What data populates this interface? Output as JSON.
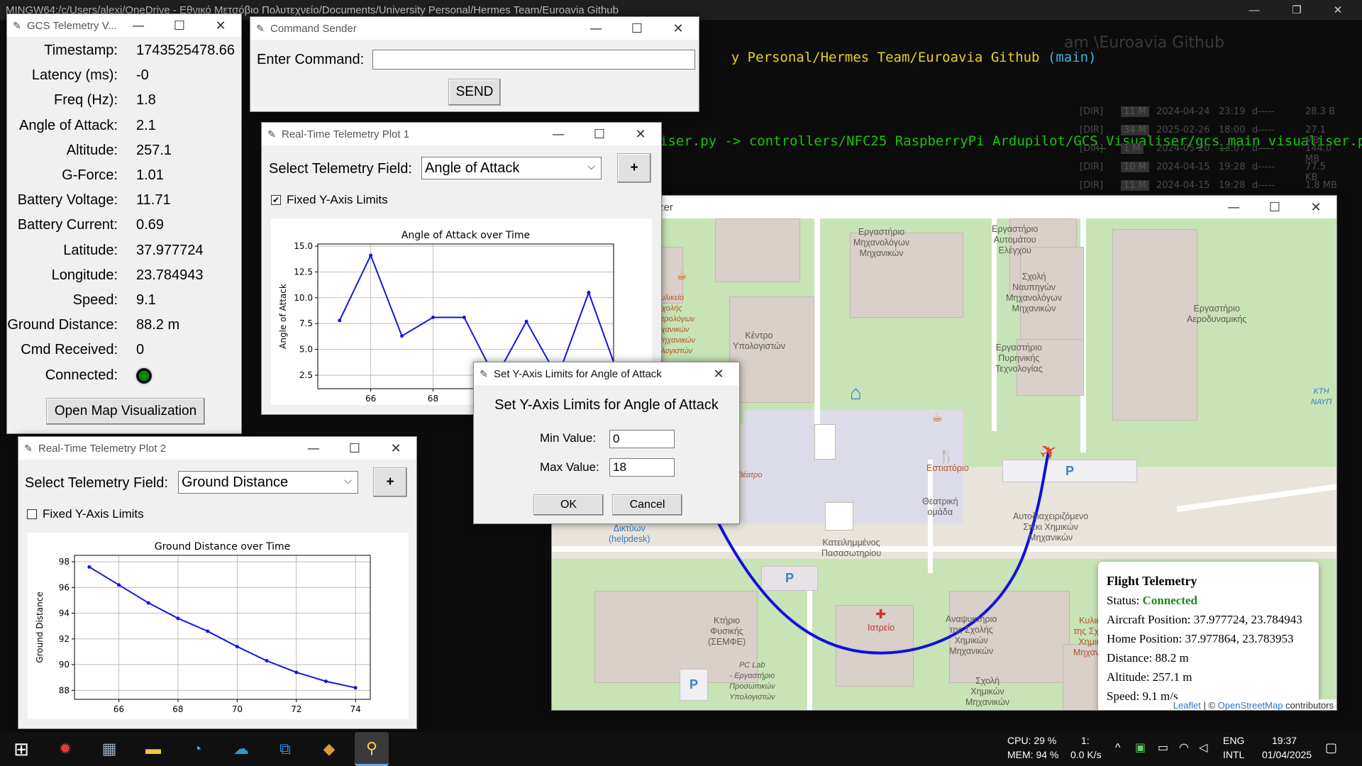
{
  "terminal": {
    "title": "MINGW64:/c/Users/alexi/OneDrive - Εθνικό Μετσόβιο Πολυτεχνείο/Documents/University Personal/Hermes Team/Euroavia Github",
    "path_line": "y Personal/Hermes Team/Euroavia Github",
    "branch": "(main)",
    "rename_line": "iser.py -> controllers/NFC25 RaspberryPi Ardupilot/GCS_Visualiser/gcs_main_visualiser.p",
    "ghost_path": "am \\Euroavia Github",
    "ghost_rows": [
      {
        "name": "[DIR]",
        "size": "11 M",
        "date": "2024-04-24",
        "time": "23:19",
        "attr": "d-----",
        "bytes": "28.3 B"
      },
      {
        "name": "[DIR]",
        "size": "34 M",
        "date": "2025-02-26",
        "time": "18:00",
        "attr": "d-----",
        "bytes": "27.1 MB"
      },
      {
        "name": "[DIR]",
        "size": "1 M",
        "date": "2024-05-20",
        "time": "13:07",
        "attr": "d-----",
        "bytes": "144.0 MB"
      },
      {
        "name": "[DIR]",
        "size": "10 M",
        "date": "2024-04-15",
        "time": "19:28",
        "attr": "d-----",
        "bytes": "77.5 KB"
      },
      {
        "name": "[DIR]",
        "size": "11 M",
        "date": "2024-04-15",
        "time": "19:28",
        "attr": "d-----",
        "bytes": "1.8 MB"
      }
    ]
  },
  "telemetry_window": {
    "title": "GCS Telemetry V...",
    "fields": [
      {
        "label": "Timestamp:",
        "value": "1743525478.66"
      },
      {
        "label": "Latency (ms):",
        "value": "-0"
      },
      {
        "label": "Freq (Hz):",
        "value": "1.8"
      },
      {
        "label": "Angle of Attack:",
        "value": "2.1"
      },
      {
        "label": "Altitude:",
        "value": "257.1"
      },
      {
        "label": "G-Force:",
        "value": "1.01"
      },
      {
        "label": "Battery Voltage:",
        "value": "11.71"
      },
      {
        "label": "Battery Current:",
        "value": "0.69"
      },
      {
        "label": "Latitude:",
        "value": "37.977724"
      },
      {
        "label": "Longitude:",
        "value": "23.784943"
      },
      {
        "label": "Speed:",
        "value": "9.1"
      },
      {
        "label": "Ground Distance:",
        "value": "88.2 m"
      },
      {
        "label": "Cmd Received:",
        "value": "0"
      }
    ],
    "connected_label": "Connected:",
    "connected_color": "#0a8a0a",
    "open_map_button": "Open Map Visualization"
  },
  "command_window": {
    "title": "Command Sender",
    "label": "Enter Command:",
    "input_value": "",
    "send_button": "SEND"
  },
  "plot1_window": {
    "title": "Real-Time Telemetry Plot 1",
    "select_label": "Select Telemetry Field:",
    "selected_field": "Angle of Attack",
    "add_button": "+",
    "fixed_limits_label": "Fixed Y-Axis Limits",
    "fixed_limits_checked": true,
    "check_mark": "✔"
  },
  "plot2_window": {
    "title": "Real-Time Telemetry Plot 2",
    "select_label": "Select Telemetry Field:",
    "selected_field": "Ground Distance",
    "add_button": "+",
    "fixed_limits_label": "Fixed Y-Axis Limits",
    "fixed_limits_checked": false
  },
  "dialog": {
    "title": "Set Y-Axis Limits for Angle of Attack",
    "heading": "Set Y-Axis Limits for Angle of Attack",
    "min_label": "Min Value:",
    "min_value": "0",
    "max_label": "Max Value:",
    "max_value": "18",
    "ok_button": "OK",
    "cancel_button": "Cancel"
  },
  "map_window": {
    "title": "zer",
    "popup": {
      "title": "Flight Telemetry",
      "status_label": "Status:",
      "status_value": "Connected",
      "aircraft": "Aircraft Position: 37.977724, 23.784943",
      "home": "Home Position: 37.977864, 23.783953",
      "distance": "Distance: 88.2 m",
      "altitude": "Altitude: 257.1 m",
      "speed": "Speed: 9.1 m/s"
    },
    "attribution_leaflet": "Leaflet",
    "attribution_sep": "| ©",
    "attribution_osm": "OpenStreetMap",
    "attribution_rest": "contributors",
    "labels": [
      "Εργαστήριο\nΑυτομάτου\nΕλέγχου",
      "Εργαστήριο\nΜηχανολόγων\nΜηχανικών",
      "Σχολή\nΝαυπηγών\nΜηχανολόγων\nΜηχανικών",
      "Εργαστήριο\nΑεροδυναμικής",
      "Κέντρο\nΥπολογιστών",
      "Κυλικείο\nΣχολής\nΗλεκτρολόγων\nΜηχανικών\nκαι Μηχανικών\nΥπολογιστών",
      "Εργαστήριο\nΠυρηνικής\nΤεχνολογίας",
      "Εστιατόριο",
      "Θεατρική\nομάδα",
      "Αυτοδιαχειριζόμενο\nΣτέκι Χημικών\nΜηχανικών",
      "Κατειλημμένος\nΠασασωτηρίου",
      "Κτήριο\nΦυσικής\n(ΣΕΜΦΕ)",
      "Ιατρείο",
      "Αναψυκτήριο\nτης Σχολής\nΧημικών\nΜηχανικών",
      "Κυλικείο\nτης Σχολής\nΧημικών\nΜηχανικών",
      "Σχολή\nΧημικών\nΜηχανικών",
      "PC Lab\n- Εργαστήριο\nΠροσωπικών\nΥπολογιστών",
      "Δικτύων\n(helpdesk)",
      "Αμφιθέατρο",
      "ΚΤΗ\nΝΑΥΠ"
    ]
  },
  "plot1_chart": {
    "chart_data": {
      "type": "line",
      "title": "Angle of Attack over Time",
      "xlabel": "",
      "ylabel": "Angle of Attack",
      "x": [
        65,
        66,
        67,
        68,
        69,
        70,
        71,
        72,
        73,
        74
      ],
      "y": [
        7.8,
        14.1,
        6.3,
        8.1,
        8.1,
        2.2,
        7.7,
        2.3,
        10.5,
        2.1
      ],
      "xticks": [
        "66",
        "68"
      ],
      "yticks": [
        "2.5",
        "5.0",
        "7.5",
        "10.0",
        "12.5",
        "15.0"
      ],
      "xlim": [
        64.3,
        73.8
      ],
      "ylim": [
        1.2,
        15.2
      ],
      "grid": true,
      "color": "#1515e0"
    }
  },
  "plot2_chart": {
    "chart_data": {
      "type": "line",
      "title": "Ground Distance over Time",
      "xlabel": "",
      "ylabel": "Ground Distance",
      "x": [
        65,
        66,
        67,
        68,
        69,
        70,
        71,
        72,
        73,
        74
      ],
      "y": [
        97.6,
        96.2,
        94.8,
        93.6,
        92.6,
        91.4,
        90.3,
        89.4,
        88.7,
        88.2
      ],
      "xticks": [
        "66",
        "68",
        "70",
        "72",
        "74"
      ],
      "yticks": [
        "88",
        "90",
        "92",
        "94",
        "96",
        "98"
      ],
      "xlim": [
        64.5,
        74.5
      ],
      "ylim": [
        87.3,
        98.5
      ],
      "grid": true,
      "color": "#1515e0"
    }
  },
  "taskbar": {
    "cpu": "CPU: 29 %",
    "mem": "MEM: 94 %",
    "net1": "1:",
    "net2": "0.0 K/s",
    "lang1": "ENG",
    "lang2": "INTL",
    "time": "19:37",
    "date": "01/04/2025"
  }
}
